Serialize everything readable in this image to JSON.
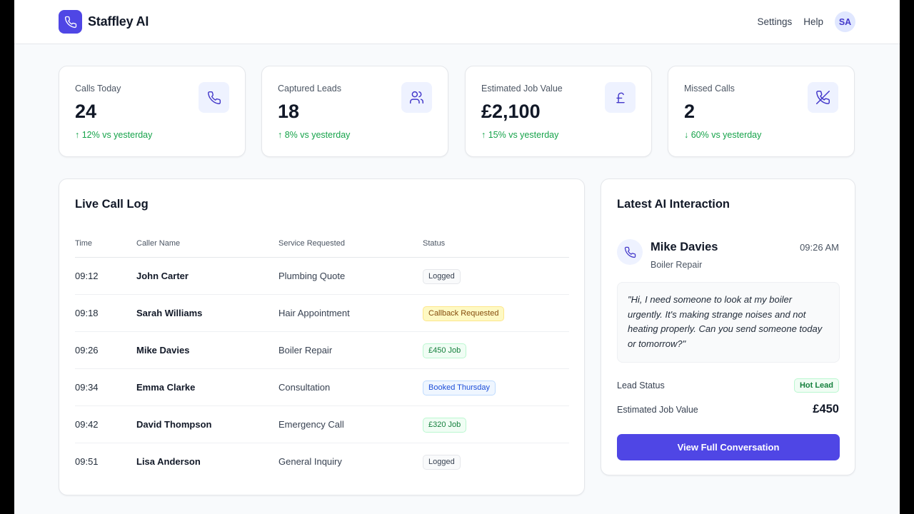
{
  "header": {
    "brand_name": "Staffley AI",
    "brand_icon": "phone-icon",
    "nav": [
      "Settings",
      "Help"
    ],
    "avatar_initials": "SA"
  },
  "stats": [
    {
      "label": "Calls Today",
      "value": "24",
      "change": "↑ 12% vs yesterday",
      "icon": "phone-icon"
    },
    {
      "label": "Captured Leads",
      "value": "18",
      "change": "↑ 8% vs yesterday",
      "icon": "users-icon"
    },
    {
      "label": "Estimated Job Value",
      "value": "£2,100",
      "change": "↑ 15% vs yesterday",
      "icon": "pound-icon"
    },
    {
      "label": "Missed Calls",
      "value": "2",
      "change": "↓ 60% vs yesterday",
      "icon": "missed-call-icon"
    }
  ],
  "call_log": {
    "title": "Live Call Log",
    "columns": [
      "Time",
      "Caller Name",
      "Service Requested",
      "Status"
    ],
    "rows": [
      {
        "time": "09:12",
        "name": "John Carter",
        "service": "Plumbing Quote",
        "status": "Logged"
      },
      {
        "time": "09:18",
        "name": "Sarah Williams",
        "service": "Hair Appointment",
        "status": "Callback Requested"
      },
      {
        "time": "09:26",
        "name": "Mike Davies",
        "service": "Boiler Repair",
        "status": "£450 Job"
      },
      {
        "time": "09:34",
        "name": "Emma Clarke",
        "service": "Consultation",
        "status": "Booked Thursday"
      },
      {
        "time": "09:42",
        "name": "David Thompson",
        "service": "Emergency Call",
        "status": "£320 Job"
      },
      {
        "time": "09:51",
        "name": "Lisa Anderson",
        "service": "General Inquiry",
        "status": "Logged"
      }
    ]
  },
  "latest": {
    "title": "Latest AI Interaction",
    "caller_name": "Mike Davies",
    "time": "09:26 AM",
    "service": "Boiler Repair",
    "quote": "\"Hi, I need someone to look at my boiler urgently. It's making strange noises and not heating properly. Can you send someone today or tomorrow?\"",
    "lead_status_label": "Lead Status",
    "lead_status": "Hot Lead",
    "job_value_label": "Estimated Job Value",
    "job_value": "£450",
    "cta": "View Full Conversation"
  },
  "colors": {
    "accent": "#4f46e5",
    "positive": "#16a34a",
    "background": "#f8fafc"
  }
}
